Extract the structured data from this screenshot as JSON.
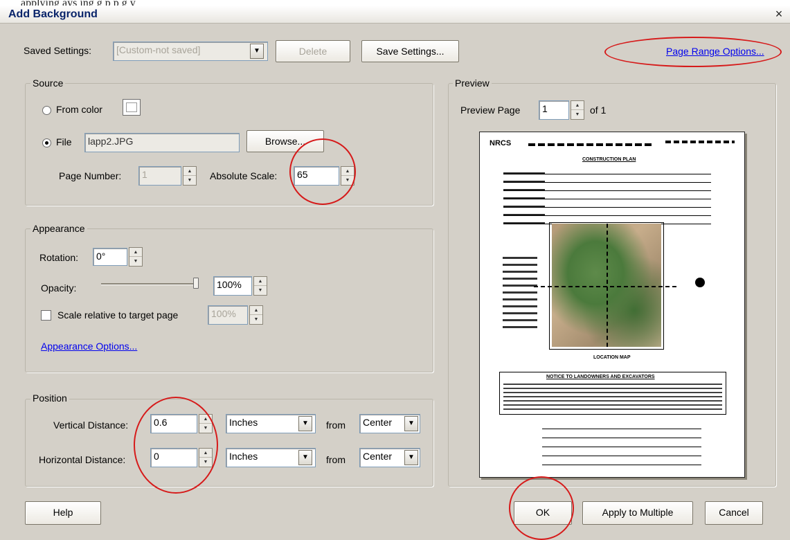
{
  "top_strip": {
    "text": "applying     ays    ing   g   p       p g y"
  },
  "window": {
    "title": "Add Background",
    "close_symbol": "×"
  },
  "saved_settings": {
    "label": "Saved Settings:",
    "value": "[Custom-not saved]",
    "delete_label": "Delete",
    "save_label": "Save Settings...",
    "page_range_link": "Page Range Options..."
  },
  "source": {
    "group_label": "Source",
    "from_color_label": "From color",
    "file_label": "File",
    "file_value": "lapp2.JPG",
    "browse_label": "Browse...",
    "page_number_label": "Page Number:",
    "page_number_value": "1",
    "absolute_scale_label": "Absolute Scale:",
    "absolute_scale_value": "65"
  },
  "appearance": {
    "group_label": "Appearance",
    "rotation_label": "Rotation:",
    "rotation_value": "0°",
    "opacity_label": "Opacity:",
    "opacity_value": "100%",
    "opacity_level": 1.0,
    "scale_relative_label": "Scale relative to target page",
    "scale_relative_value": "100%",
    "options_link": "Appearance Options..."
  },
  "position": {
    "group_label": "Position",
    "vertical_label": "Vertical Distance:",
    "vertical_value": "0.6",
    "vertical_unit": "Inches",
    "vertical_from_label": "from",
    "vertical_from_value": "Center",
    "horizontal_label": "Horizontal Distance:",
    "horizontal_value": "0",
    "horizontal_unit": "Inches",
    "horizontal_from_label": "from",
    "horizontal_from_value": "Center"
  },
  "preview": {
    "group_label": "Preview",
    "page_label": "Preview Page",
    "page_value": "1",
    "of_label": "of 1",
    "doc": {
      "logo": "NRCS",
      "plan_title": "CONSTRUCTION PLAN",
      "map_caption": "LOCATION MAP",
      "notice_title": "NOTICE TO LANDOWNERS AND EXCAVATORS"
    }
  },
  "buttons": {
    "help": "Help",
    "ok": "OK",
    "apply_multiple": "Apply to Multiple",
    "cancel": "Cancel"
  },
  "annotation_color": "#d61a1a"
}
